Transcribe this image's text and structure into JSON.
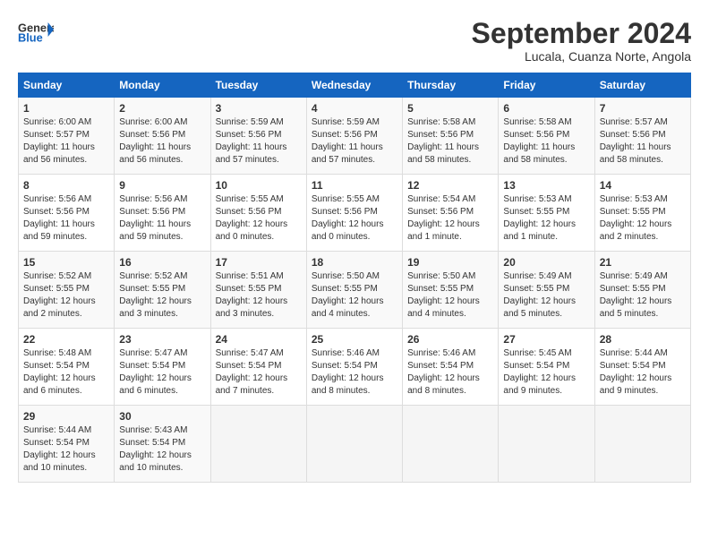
{
  "header": {
    "logo_general": "General",
    "logo_blue": "Blue",
    "title": "September 2024",
    "subtitle": "Lucala, Cuanza Norte, Angola"
  },
  "calendar": {
    "days_of_week": [
      "Sunday",
      "Monday",
      "Tuesday",
      "Wednesday",
      "Thursday",
      "Friday",
      "Saturday"
    ],
    "weeks": [
      [
        {
          "day": "1",
          "sunrise": "6:00 AM",
          "sunset": "5:57 PM",
          "daylight": "11 hours and 56 minutes."
        },
        {
          "day": "2",
          "sunrise": "6:00 AM",
          "sunset": "5:56 PM",
          "daylight": "11 hours and 56 minutes."
        },
        {
          "day": "3",
          "sunrise": "5:59 AM",
          "sunset": "5:56 PM",
          "daylight": "11 hours and 57 minutes."
        },
        {
          "day": "4",
          "sunrise": "5:59 AM",
          "sunset": "5:56 PM",
          "daylight": "11 hours and 57 minutes."
        },
        {
          "day": "5",
          "sunrise": "5:58 AM",
          "sunset": "5:56 PM",
          "daylight": "11 hours and 58 minutes."
        },
        {
          "day": "6",
          "sunrise": "5:58 AM",
          "sunset": "5:56 PM",
          "daylight": "11 hours and 58 minutes."
        },
        {
          "day": "7",
          "sunrise": "5:57 AM",
          "sunset": "5:56 PM",
          "daylight": "11 hours and 58 minutes."
        }
      ],
      [
        {
          "day": "8",
          "sunrise": "5:56 AM",
          "sunset": "5:56 PM",
          "daylight": "11 hours and 59 minutes."
        },
        {
          "day": "9",
          "sunrise": "5:56 AM",
          "sunset": "5:56 PM",
          "daylight": "11 hours and 59 minutes."
        },
        {
          "day": "10",
          "sunrise": "5:55 AM",
          "sunset": "5:56 PM",
          "daylight": "12 hours and 0 minutes."
        },
        {
          "day": "11",
          "sunrise": "5:55 AM",
          "sunset": "5:56 PM",
          "daylight": "12 hours and 0 minutes."
        },
        {
          "day": "12",
          "sunrise": "5:54 AM",
          "sunset": "5:56 PM",
          "daylight": "12 hours and 1 minute."
        },
        {
          "day": "13",
          "sunrise": "5:53 AM",
          "sunset": "5:55 PM",
          "daylight": "12 hours and 1 minute."
        },
        {
          "day": "14",
          "sunrise": "5:53 AM",
          "sunset": "5:55 PM",
          "daylight": "12 hours and 2 minutes."
        }
      ],
      [
        {
          "day": "15",
          "sunrise": "5:52 AM",
          "sunset": "5:55 PM",
          "daylight": "12 hours and 2 minutes."
        },
        {
          "day": "16",
          "sunrise": "5:52 AM",
          "sunset": "5:55 PM",
          "daylight": "12 hours and 3 minutes."
        },
        {
          "day": "17",
          "sunrise": "5:51 AM",
          "sunset": "5:55 PM",
          "daylight": "12 hours and 3 minutes."
        },
        {
          "day": "18",
          "sunrise": "5:50 AM",
          "sunset": "5:55 PM",
          "daylight": "12 hours and 4 minutes."
        },
        {
          "day": "19",
          "sunrise": "5:50 AM",
          "sunset": "5:55 PM",
          "daylight": "12 hours and 4 minutes."
        },
        {
          "day": "20",
          "sunrise": "5:49 AM",
          "sunset": "5:55 PM",
          "daylight": "12 hours and 5 minutes."
        },
        {
          "day": "21",
          "sunrise": "5:49 AM",
          "sunset": "5:55 PM",
          "daylight": "12 hours and 5 minutes."
        }
      ],
      [
        {
          "day": "22",
          "sunrise": "5:48 AM",
          "sunset": "5:54 PM",
          "daylight": "12 hours and 6 minutes."
        },
        {
          "day": "23",
          "sunrise": "5:47 AM",
          "sunset": "5:54 PM",
          "daylight": "12 hours and 6 minutes."
        },
        {
          "day": "24",
          "sunrise": "5:47 AM",
          "sunset": "5:54 PM",
          "daylight": "12 hours and 7 minutes."
        },
        {
          "day": "25",
          "sunrise": "5:46 AM",
          "sunset": "5:54 PM",
          "daylight": "12 hours and 8 minutes."
        },
        {
          "day": "26",
          "sunrise": "5:46 AM",
          "sunset": "5:54 PM",
          "daylight": "12 hours and 8 minutes."
        },
        {
          "day": "27",
          "sunrise": "5:45 AM",
          "sunset": "5:54 PM",
          "daylight": "12 hours and 9 minutes."
        },
        {
          "day": "28",
          "sunrise": "5:44 AM",
          "sunset": "5:54 PM",
          "daylight": "12 hours and 9 minutes."
        }
      ],
      [
        {
          "day": "29",
          "sunrise": "5:44 AM",
          "sunset": "5:54 PM",
          "daylight": "12 hours and 10 minutes."
        },
        {
          "day": "30",
          "sunrise": "5:43 AM",
          "sunset": "5:54 PM",
          "daylight": "12 hours and 10 minutes."
        },
        null,
        null,
        null,
        null,
        null
      ]
    ]
  }
}
